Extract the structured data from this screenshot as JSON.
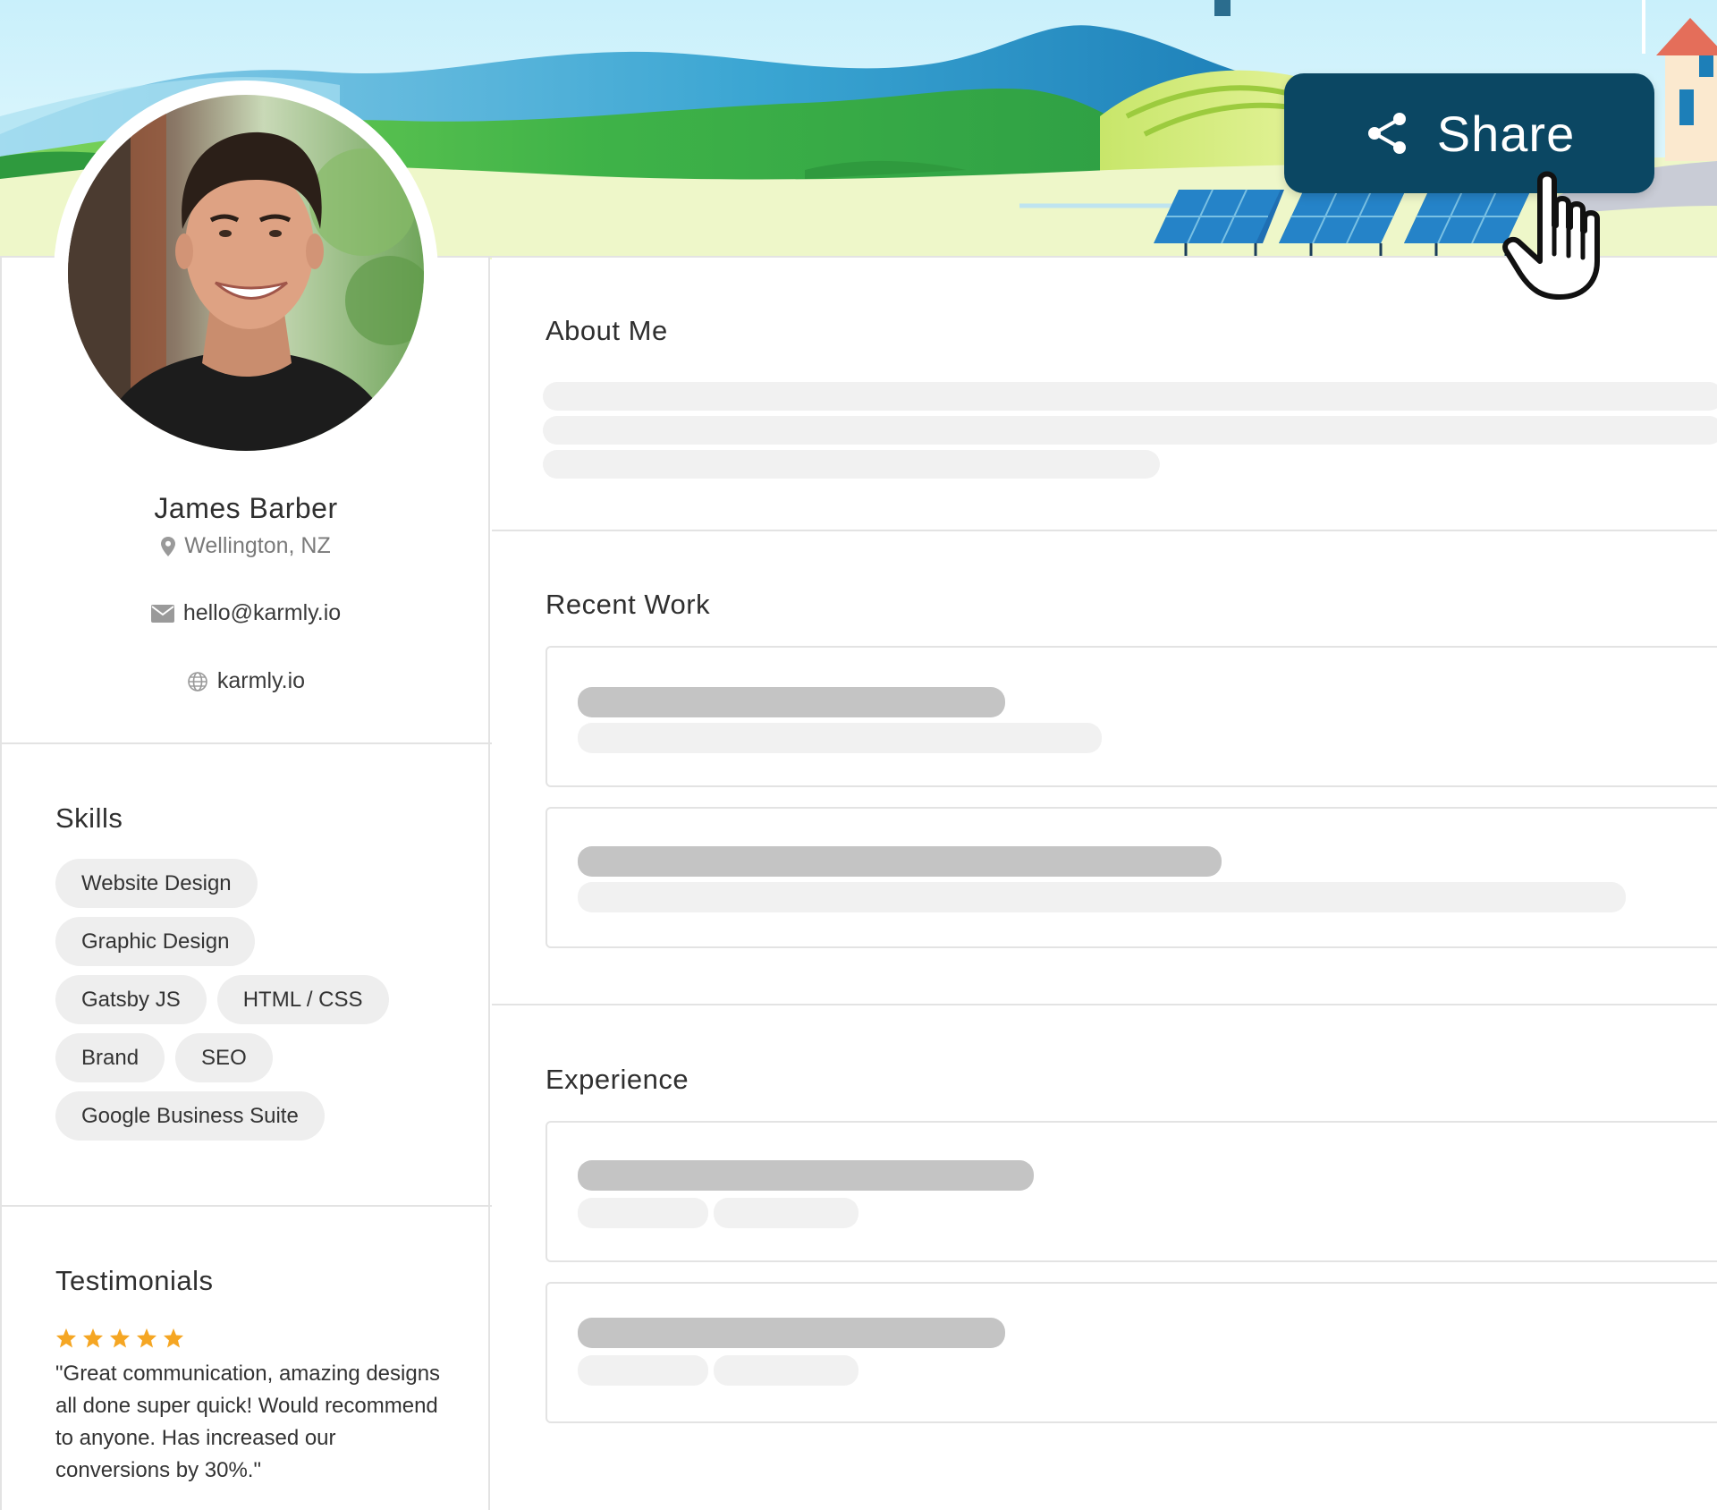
{
  "share": {
    "label": "Share"
  },
  "profile": {
    "name": "James Barber",
    "location": "Wellington, NZ",
    "email": "hello@karmly.io",
    "website": "karmly.io"
  },
  "sections": {
    "about": "About Me",
    "recent_work": "Recent Work",
    "experience": "Experience",
    "skills": "Skills",
    "testimonials": "Testimonials"
  },
  "skills": [
    [
      "Website Design"
    ],
    [
      "Graphic Design"
    ],
    [
      "Gatsby JS",
      "HTML / CSS"
    ],
    [
      "Brand",
      "SEO"
    ],
    [
      "Google Business Suite"
    ]
  ],
  "testimonial": {
    "rating": 5,
    "text": "\"Great communication, amazing designs all done super quick! Would recommend to anyone. Has increased our conversions by 30%.\""
  },
  "colors": {
    "share_bg": "#0b4763",
    "star": "#f5a623",
    "skeleton_light": "#f1f1f1",
    "skeleton_dark": "#c4c4c4"
  },
  "icons": [
    "share-icon",
    "hand-cursor-icon",
    "location-pin-icon",
    "mail-icon",
    "globe-icon",
    "star-icon"
  ]
}
